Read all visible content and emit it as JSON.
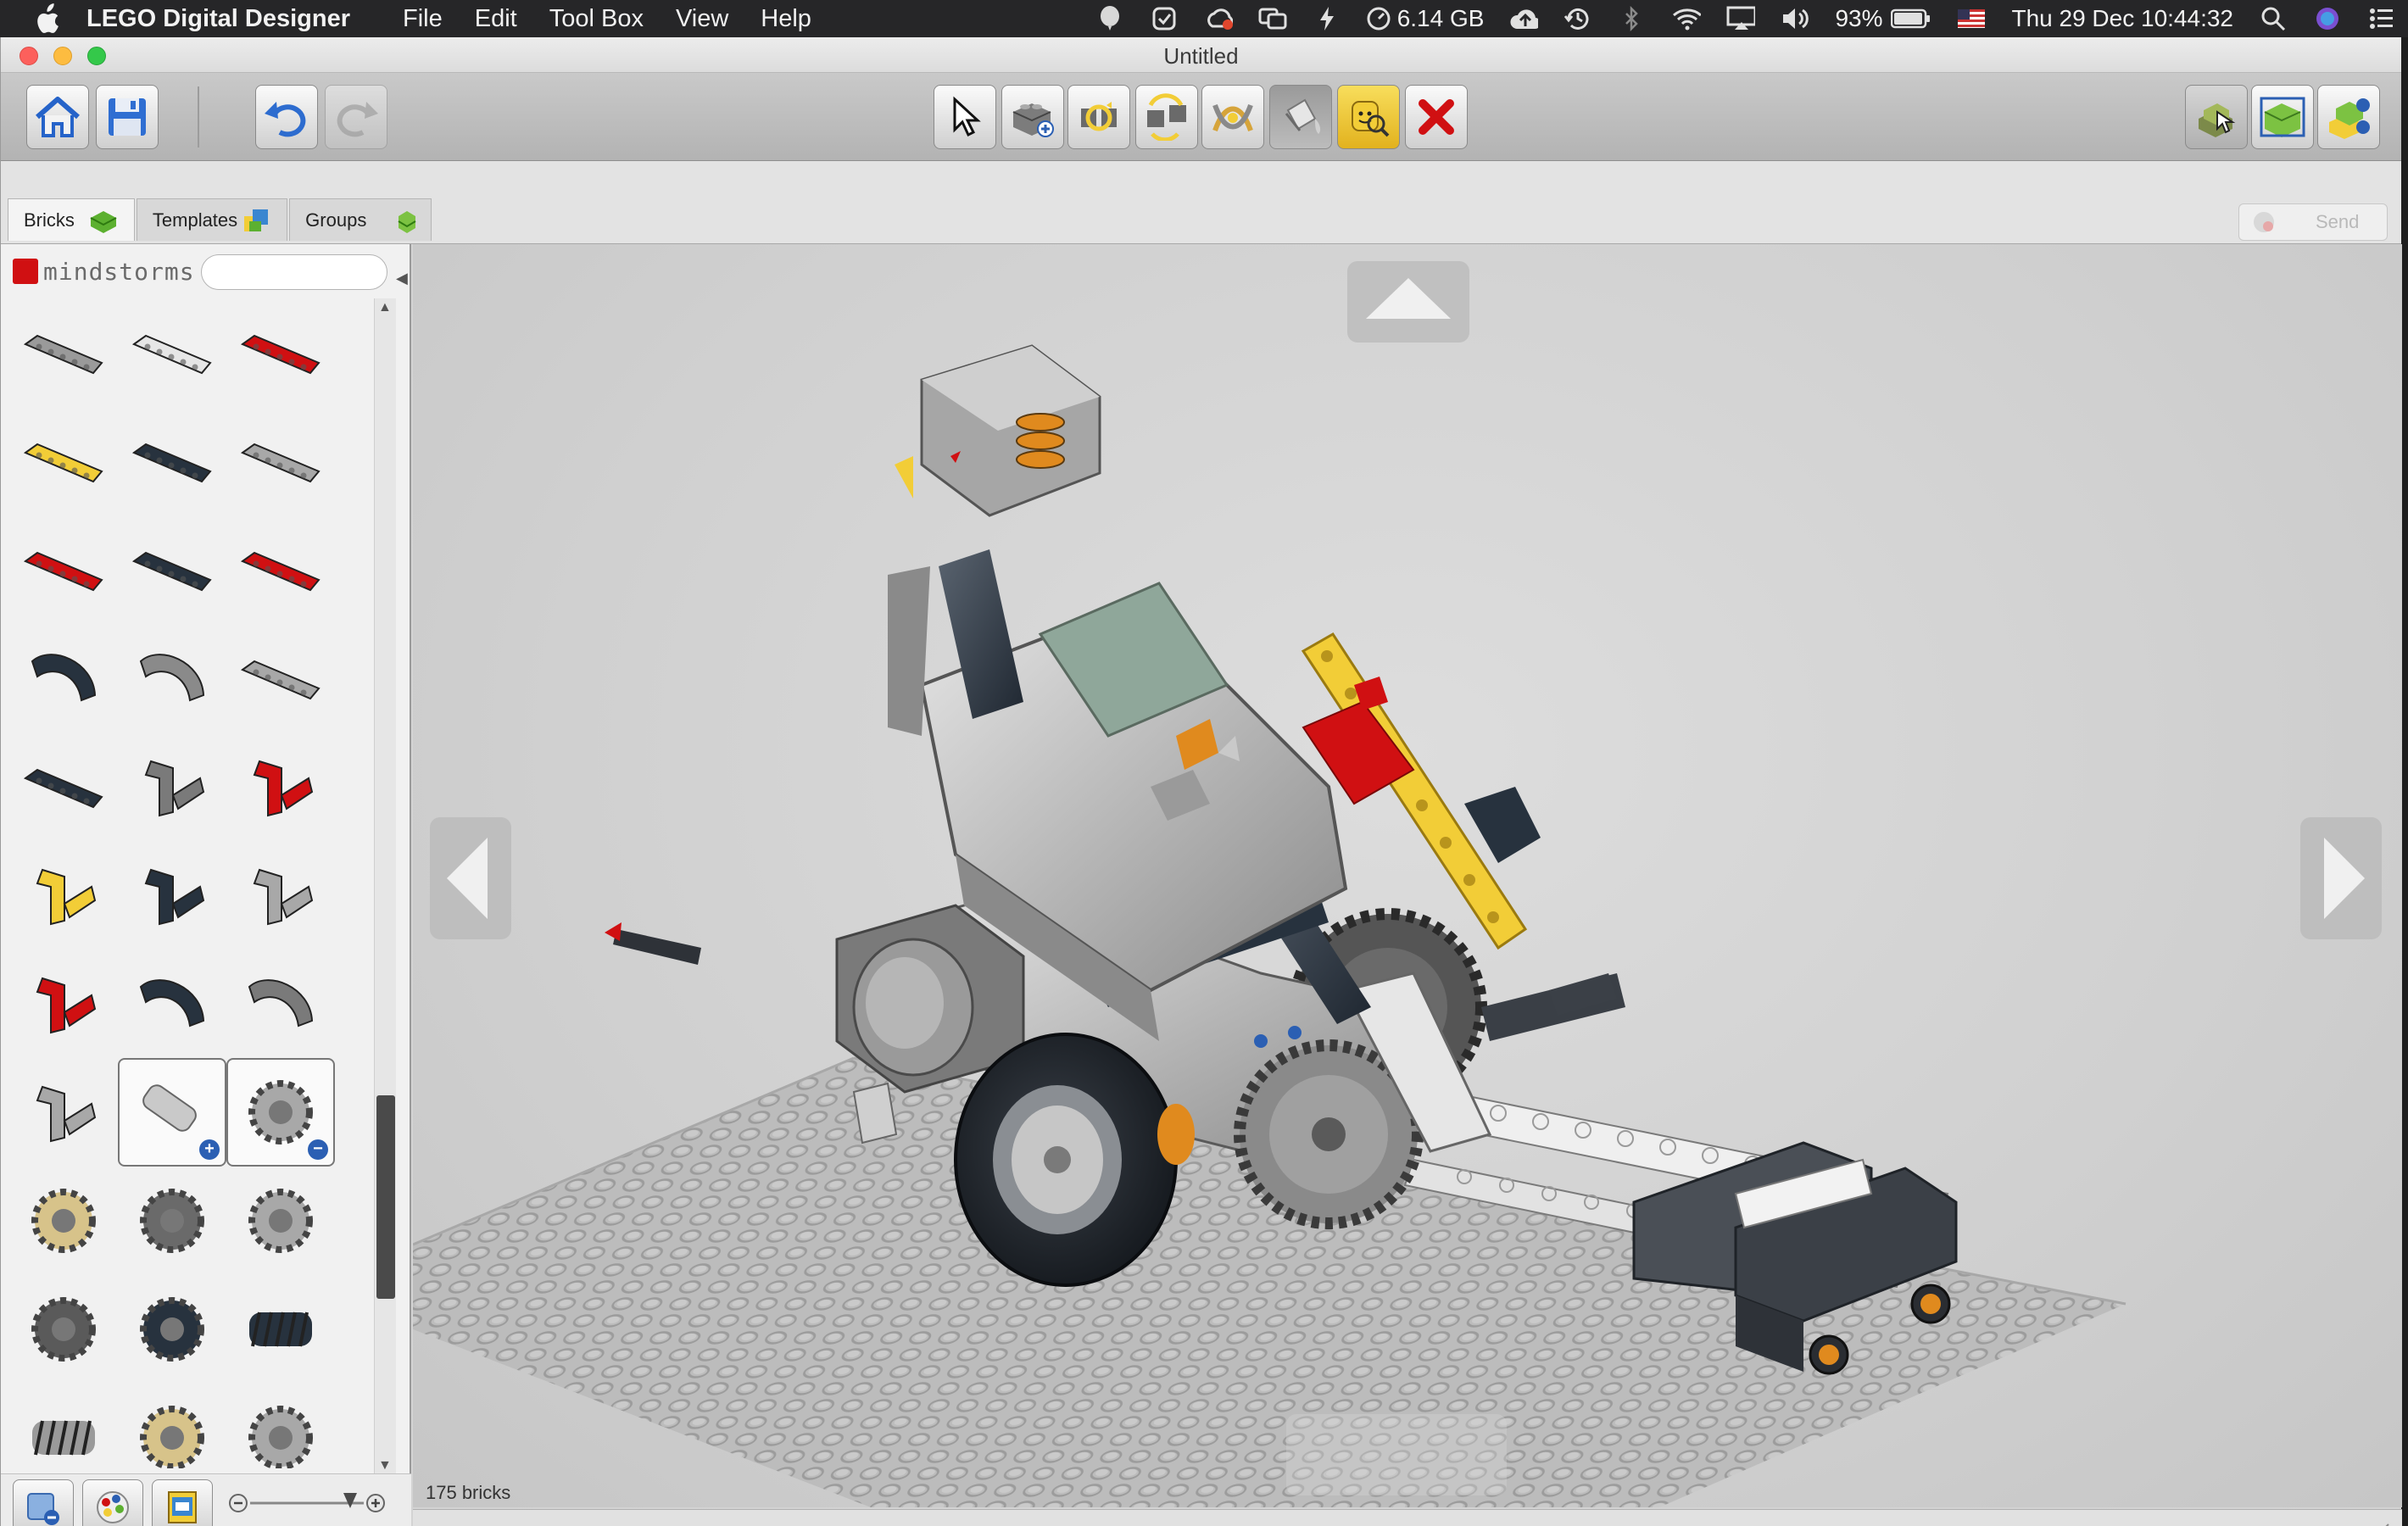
{
  "menubar": {
    "app_name": "LEGO Digital Designer",
    "menus": [
      "File",
      "Edit",
      "Tool Box",
      "View",
      "Help"
    ],
    "memory": "6.14 GB",
    "battery": "93%",
    "datetime": "Thu 29 Dec  10:44:32"
  },
  "window": {
    "title": "Untitled"
  },
  "tabs": [
    {
      "label": "Bricks",
      "active": true
    },
    {
      "label": "Templates",
      "active": false
    },
    {
      "label": "Groups",
      "active": false
    }
  ],
  "send_label": "Send",
  "palette": {
    "brand": "mindstorms",
    "search_placeholder": "",
    "bricks": [
      {
        "icon": "beam-light-gray",
        "color": "#9a9a9a"
      },
      {
        "icon": "beam-white",
        "color": "#e6e6e6"
      },
      {
        "icon": "beam-red",
        "color": "#d01012"
      },
      {
        "icon": "beam-yellow",
        "color": "#f2cd37"
      },
      {
        "icon": "beam-dark-blue-gray",
        "color": "#27323e"
      },
      {
        "icon": "beam-light-gray",
        "color": "#a8a8a8"
      },
      {
        "icon": "beam-red",
        "color": "#d01012"
      },
      {
        "icon": "beam-dark-blue-gray",
        "color": "#27323e"
      },
      {
        "icon": "beam-red",
        "color": "#d01012"
      },
      {
        "icon": "curved-beam-dark",
        "color": "#27323e"
      },
      {
        "icon": "curved-beam-gray",
        "color": "#8a8a8a"
      },
      {
        "icon": "long-beam-gray",
        "color": "#a8a8a8"
      },
      {
        "icon": "long-beam-dark",
        "color": "#27323e"
      },
      {
        "icon": "angle-beam-gray",
        "color": "#7a7a7a"
      },
      {
        "icon": "angle-beam-red",
        "color": "#d01012"
      },
      {
        "icon": "angle-beam-yellow",
        "color": "#f2cd37"
      },
      {
        "icon": "angle-connector-dark",
        "color": "#27323e"
      },
      {
        "icon": "angle-connector-gray",
        "color": "#a8a8a8"
      },
      {
        "icon": "angle-connector-red",
        "color": "#d01012"
      },
      {
        "icon": "loop-beam-dark",
        "color": "#27323e"
      },
      {
        "icon": "loop-beam-gray",
        "color": "#7a7a7a"
      },
      {
        "icon": "connector-gray",
        "color": "#a8a8a8"
      },
      {
        "icon": "add-part-icon",
        "color": "#9a9a9a"
      },
      {
        "icon": "remove-gear-icon",
        "color": "#a8a8a8"
      },
      {
        "icon": "gear-tan",
        "color": "#d7c38a"
      },
      {
        "icon": "gear-dark-gray",
        "color": "#6a6a6a"
      },
      {
        "icon": "gear-light-gray",
        "color": "#a8a8a8"
      },
      {
        "icon": "gear-dark-gray",
        "color": "#5a5a5a"
      },
      {
        "icon": "gear-dark-blue",
        "color": "#27323e"
      },
      {
        "icon": "worm-gear-dark",
        "color": "#27323e"
      },
      {
        "icon": "worm-gear-gray",
        "color": "#9a9a9a"
      },
      {
        "icon": "gear-tan",
        "color": "#d7c38a"
      },
      {
        "icon": "gear-light-gray",
        "color": "#a8a8a8"
      }
    ]
  },
  "status": {
    "brick_count": "175 bricks"
  },
  "colors": {
    "lego_red": "#d01012",
    "lego_yellow": "#f2cd37",
    "lego_dark": "#27323e",
    "lego_orange": "#e08a1e",
    "canvas_bg": "#d0d0d0"
  }
}
